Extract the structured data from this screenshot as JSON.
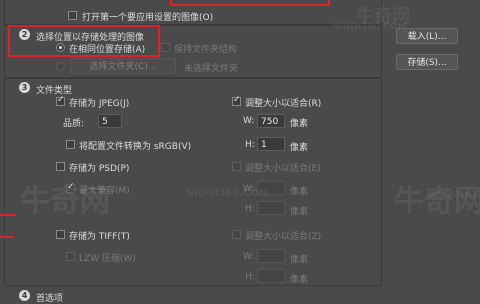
{
  "section1": {
    "open_first_image_label": "打开第一个要应用设置的图像(O)"
  },
  "section2": {
    "badge": "2",
    "title": "选择位置以存储处理的图像",
    "same_location_label": "在相同位置存储(A)",
    "keep_structure_label": "保持文件夹结构",
    "select_folder_label": "选择文件夹(C)...",
    "no_folder_label": "未选择文件夹"
  },
  "section3": {
    "badge": "3",
    "title": "文件类型",
    "jpeg": {
      "save_label": "存储为 JPEG(J)",
      "resize_label": "调整大小以适合(R)",
      "quality_label": "品质:",
      "quality_value": "5",
      "w_label": "W:",
      "w_value": "750",
      "w_unit": "像素",
      "h_label": "H:",
      "h_value": "1",
      "h_unit": "像素",
      "srgb_label": "将配置文件转换为 sRGB(V)"
    },
    "psd": {
      "save_label": "存储为 PSD(P)",
      "resize_label": "调整大小以适合(E)",
      "max_compat_label": "最大兼容(M)",
      "w_label": "W:",
      "w_unit": "像素",
      "h_label": "H:",
      "h_unit": "像素"
    },
    "tiff": {
      "save_label": "存储为 TIFF(T)",
      "resize_label": "调整大小以适合(Z)",
      "lzw_label": "LZW 压缩(W)",
      "w_label": "W:",
      "w_unit": "像素",
      "h_label": "H:",
      "h_unit": "像素"
    }
  },
  "section4": {
    "badge": "4",
    "title": "首选项"
  },
  "buttons": {
    "load": "载入(L)...",
    "save": "存储(S)..."
  },
  "watermark": {
    "brand": "NIUQI360.COM",
    "cn": "牛奇网"
  },
  "colors": {
    "background": "#4a4a4a",
    "highlight_box": "#e0202a"
  }
}
